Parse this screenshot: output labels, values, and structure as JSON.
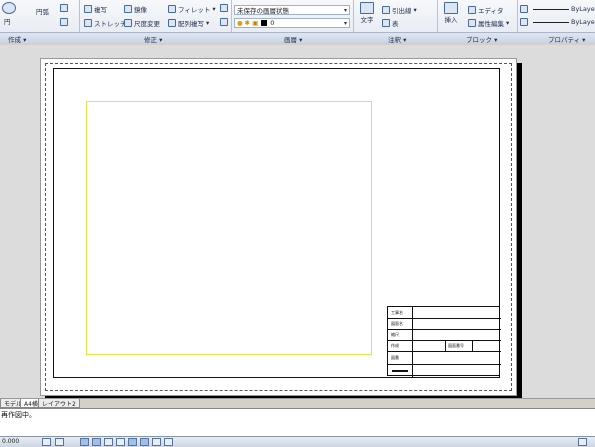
{
  "ribbon": {
    "panels": [
      {
        "title": "作成 ▾"
      },
      {
        "title": "修正 ▾"
      },
      {
        "title": "画層 ▾"
      },
      {
        "title": "注釈 ▾"
      },
      {
        "title": "ブロック ▾"
      },
      {
        "title": "プロパティ ▾"
      }
    ],
    "draw": {
      "circle": "円",
      "arc": "円弧"
    },
    "modify": {
      "copy": "複写",
      "mirror": "鏡像",
      "fillet": "フィレット",
      "stretch": "ストレッチ",
      "scale": "尺度変更",
      "array": "配列複写"
    },
    "layers": {
      "layer_state": "未保存の画層状態",
      "current_layer": "0"
    },
    "annotation": {
      "text": "文字",
      "leader": "引出線",
      "table": "表"
    },
    "block": {
      "insert": "挿入",
      "edit": "エディタ",
      "edit_attr": "属性編集"
    },
    "properties": {
      "linetype1": "ByLayer",
      "linetype2": "ByLayer"
    }
  },
  "title_block": {
    "rows": [
      "工事名",
      "図面名",
      "縮尺",
      "作成",
      "図番",
      ""
    ],
    "middle_label": "図面番号"
  },
  "tabs": [
    "モデル",
    "A4横",
    "レイアウト2"
  ],
  "active_tab_index": 1,
  "command_line": {
    "line1": "再作図中。",
    "line2": "",
    "line3": ""
  },
  "status_bar": {
    "coords": "0.000"
  }
}
